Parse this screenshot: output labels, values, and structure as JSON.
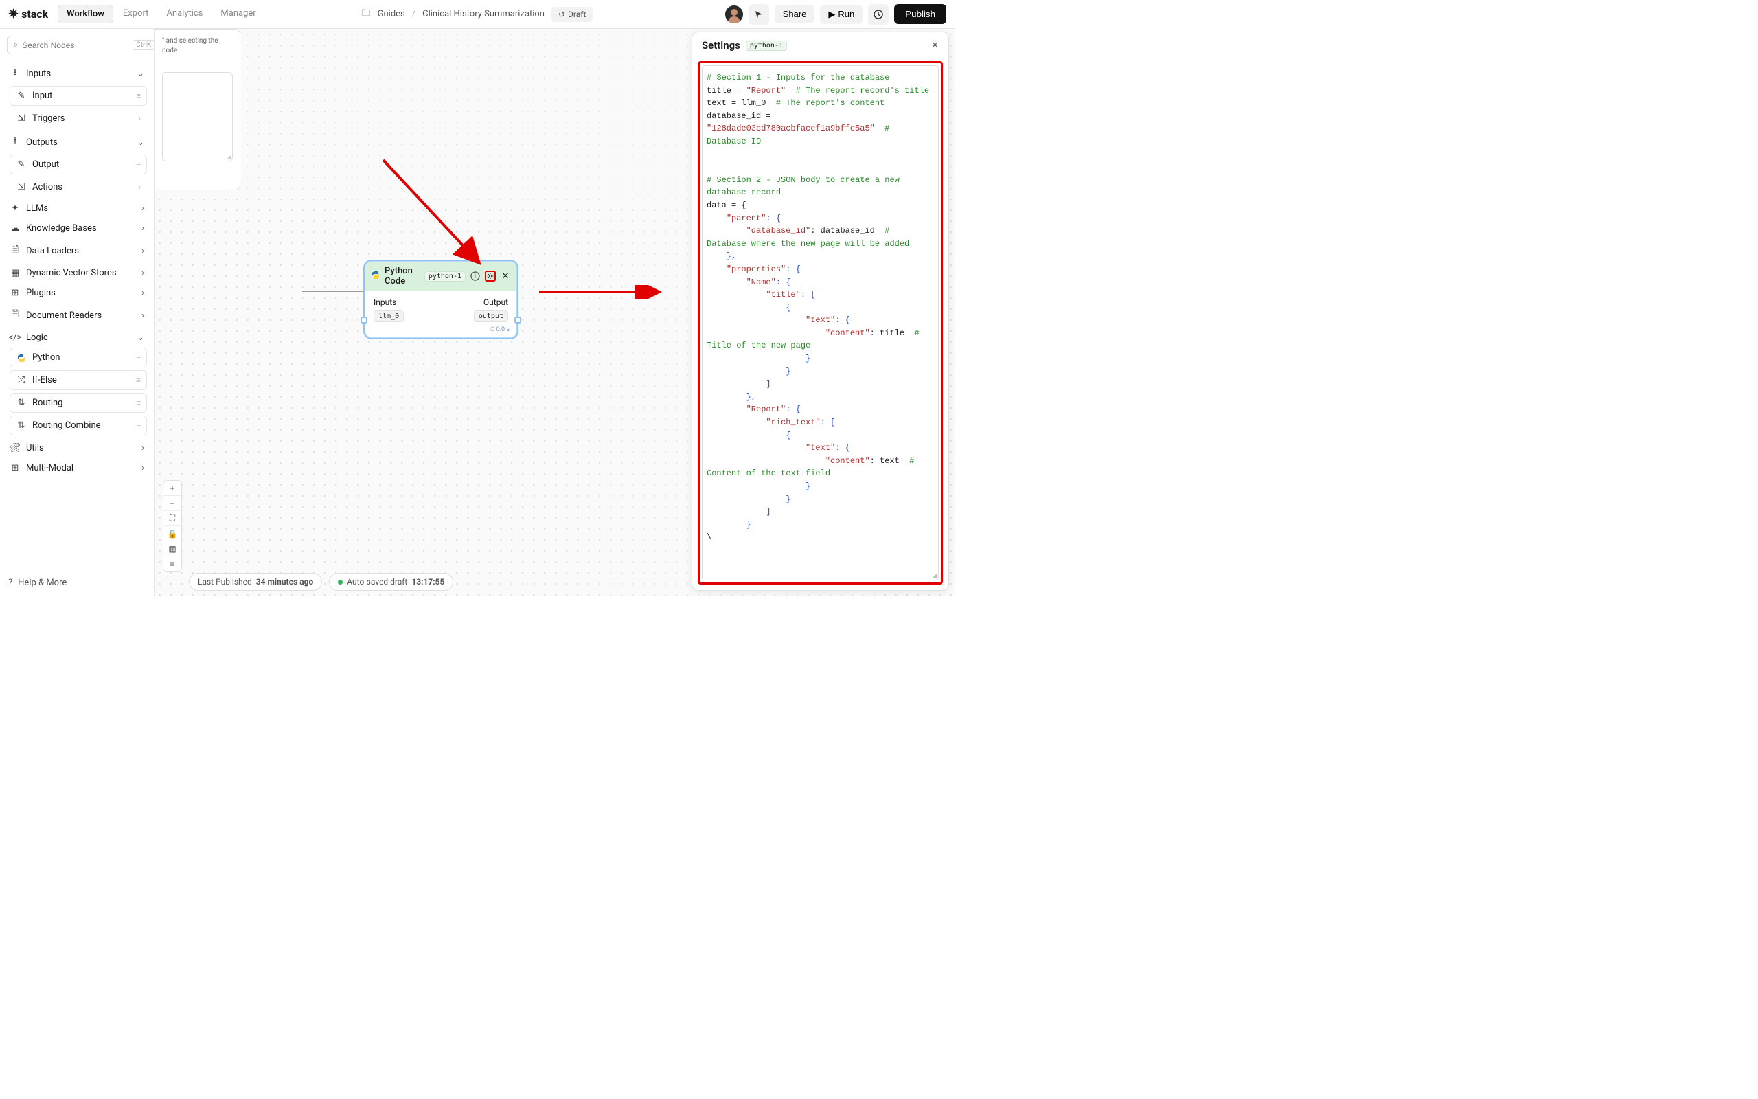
{
  "app": {
    "name": "stack"
  },
  "tabs": {
    "workflow": "Workflow",
    "export": "Export",
    "analytics": "Analytics",
    "manager": "Manager"
  },
  "breadcrumb": {
    "folder": "Guides",
    "page": "Clinical History Summarization",
    "draft": "Draft"
  },
  "toolbar": {
    "share": "Share",
    "run": "Run",
    "publish": "Publish"
  },
  "search": {
    "placeholder": "Search Nodes",
    "shortcut": "CtrlK"
  },
  "sidebar": {
    "sections": {
      "inputs": "Inputs",
      "outputs": "Outputs",
      "llms": "LLMs",
      "knowledge": "Knowledge Bases",
      "loaders": "Data Loaders",
      "vector": "Dynamic Vector Stores",
      "plugins": "Plugins",
      "readers": "Document Readers",
      "logic": "Logic",
      "utils": "Utils",
      "multimodal": "Multi-Modal"
    },
    "items": {
      "input": "Input",
      "triggers": "Triggers",
      "output": "Output",
      "actions": "Actions",
      "python": "Python",
      "ifelse": "If-Else",
      "routing": "Routing",
      "routingcombine": "Routing Combine"
    }
  },
  "help": "Help & More",
  "partial_hint": "\" and selecting the node.",
  "node": {
    "title": "Python Code",
    "badge": "python-1",
    "inputs_label": "Inputs",
    "output_label": "Output",
    "input_chip": "llm_0",
    "output_chip": "output",
    "time": "0.0 s"
  },
  "status": {
    "published_label": "Last Published",
    "published_ago": "34 minutes ago",
    "autosave": "Auto-saved draft",
    "autosave_time": "13:17:55"
  },
  "settings": {
    "title": "Settings",
    "badge": "python-1"
  },
  "code": {
    "s1": "# Section 1 - Inputs for the database",
    "l2a": "title = ",
    "l2b": "\"Report\"",
    "l2c": "  # The report record's title",
    "l3a": "text = llm_0",
    "l3b": "  # The report's content",
    "l4a": "database_id = ",
    "l5a": "\"128dade03cd780acbfacef1a9bffe5a5\"",
    "l5b": "  # Database ID",
    "s2": "# Section 2 - JSON body to create a new database record",
    "l7": "data = {",
    "l8a": "\"parent\"",
    "l8b": ": {",
    "l9a": "\"database_id\"",
    "l9b": ": database_id  ",
    "l9c": "# Database where the new page will be added",
    "l10": "},",
    "l11a": "\"properties\"",
    "l11b": ": {",
    "l12a": "\"Name\"",
    "l12b": ": {",
    "l13a": "\"title\"",
    "l13b": ": [",
    "l14": "{",
    "l15a": "\"text\"",
    "l15b": ": {",
    "l16a": "\"content\"",
    "l16b": ": title  ",
    "l16c": "# Title of the new page",
    "l17": "}",
    "l18": "}",
    "l19": "]",
    "l20": "},",
    "l21a": "\"Report\"",
    "l21b": ": {",
    "l22a": "\"rich_text\"",
    "l22b": ": [",
    "l23": "{",
    "l24a": "\"text\"",
    "l24b": ": {",
    "l25a": "\"content\"",
    "l25b": ": text  ",
    "l25c": "# Content of the text field",
    "l26": "}",
    "l27": "}",
    "l28": "]",
    "l29": "}",
    "l30": "\\"
  }
}
